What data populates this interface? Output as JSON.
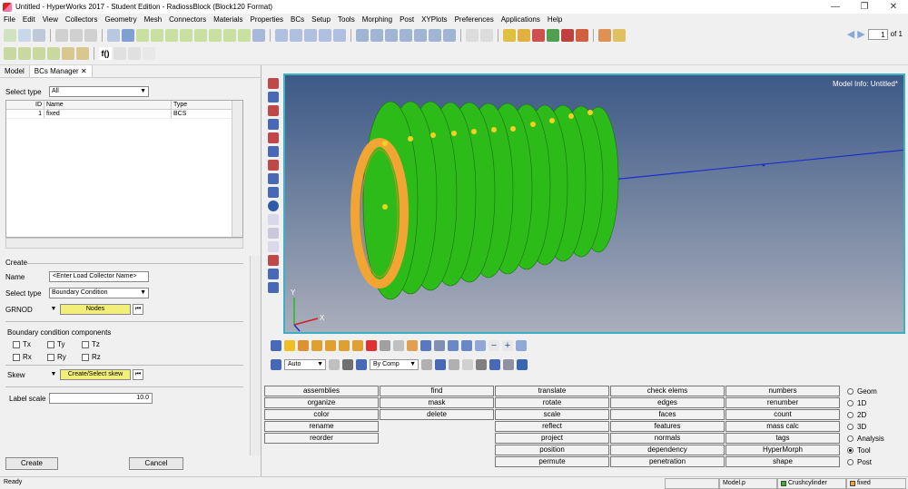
{
  "window": {
    "title": "Untitled - HyperWorks 2017 - Student Edition - RadiossBlock (Block120 Format)"
  },
  "menu": [
    "File",
    "Edit",
    "View",
    "Collectors",
    "Geometry",
    "Mesh",
    "Connectors",
    "Materials",
    "Properties",
    "BCs",
    "Setup",
    "Tools",
    "Morphing",
    "Post",
    "XYPlots",
    "Preferences",
    "Applications",
    "Help"
  ],
  "toolbar": {
    "page_value": "1",
    "page_of": "of 1"
  },
  "tabs": [
    {
      "label": "Model"
    },
    {
      "label": "BCs Manager"
    }
  ],
  "bcs_manager": {
    "select_type_label": "Select type",
    "select_type_value": "All",
    "columns": [
      "ID",
      "Name",
      "Type"
    ],
    "rows": [
      {
        "id": "1",
        "name": "fixed",
        "type": "BCS"
      }
    ]
  },
  "create": {
    "section": "Create",
    "name_label": "Name",
    "name_value": "<Enter Load Collector Name>",
    "select_type_label": "Select type",
    "select_type_value": "Boundary Condition",
    "grnod_label": "GRNOD",
    "nodes_button": "Nodes",
    "bc_components_label": "Boundary condition components",
    "components": [
      "Tx",
      "Ty",
      "Tz",
      "Rx",
      "Ry",
      "Rz"
    ],
    "skew_label": "Skew",
    "skew_button": "Create/Select skew",
    "label_scale_label": "Label scale",
    "label_scale_value": "10.0",
    "create_button": "Create",
    "cancel_button": "Cancel"
  },
  "viewport": {
    "model_info": "Model Info: Untitled*",
    "axis_x": "X",
    "axis_y": "Y"
  },
  "viewport_toolbar": {
    "view_mode": "Auto",
    "color_mode": "By Comp"
  },
  "command_panel": {
    "col1": [
      "assemblies",
      "organize",
      "color",
      "rename",
      "reorder"
    ],
    "col2": [
      "find",
      "mask",
      "delete"
    ],
    "col3": [
      "translate",
      "rotate",
      "scale",
      "reflect",
      "project",
      "position",
      "permute"
    ],
    "col4": [
      "check elems",
      "edges",
      "faces",
      "features",
      "normals",
      "dependency",
      "penetration"
    ],
    "col5": [
      "numbers",
      "renumber",
      "count",
      "mass calc",
      "tags",
      "HyperMorph",
      "shape"
    ],
    "radios": [
      "Geom",
      "1D",
      "2D",
      "3D",
      "Analysis",
      "Tool",
      "Post"
    ],
    "selected_radio": "Tool"
  },
  "status": {
    "left": "Ready",
    "model": "Model.p",
    "component": "Crushcylinder",
    "collector": "fixed"
  },
  "colors": {
    "accent_cyan": "#3db0c8",
    "mesh_green": "#2dbb1a",
    "mesh_orange": "#f2a533",
    "button_yellow": "#f1ef7a"
  }
}
